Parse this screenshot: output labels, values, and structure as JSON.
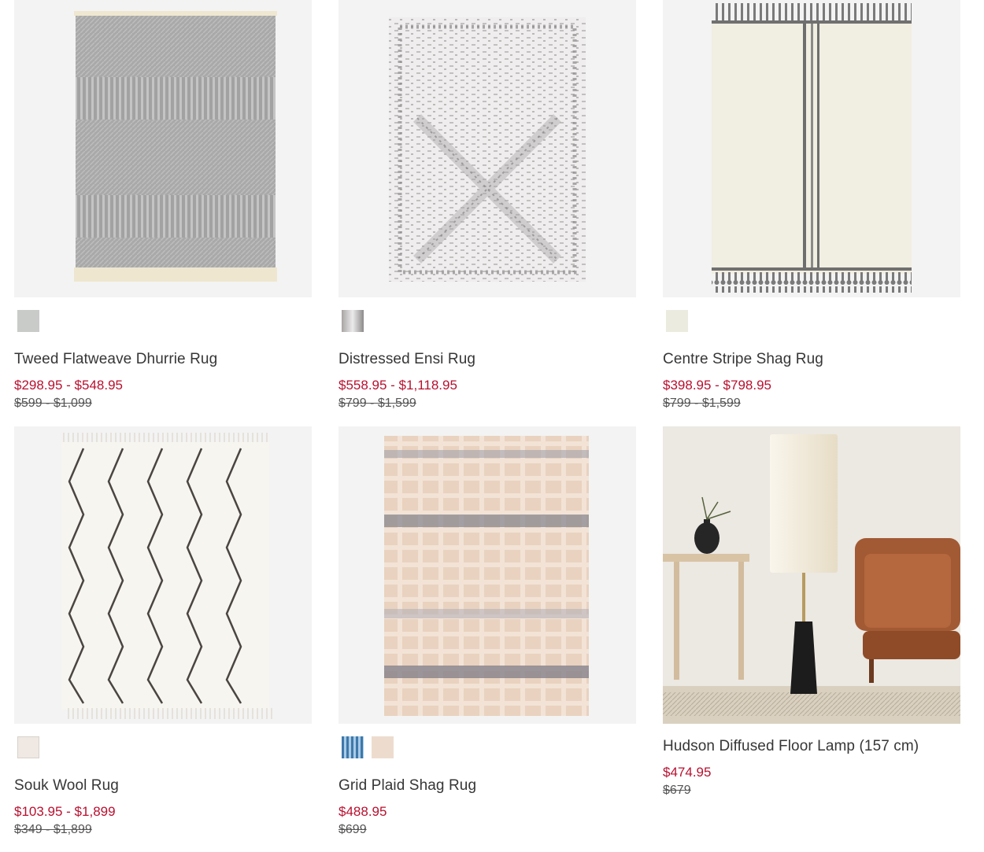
{
  "products": [
    {
      "title": "Tweed Flatweave Dhurrie Rug",
      "price": "$298.95 - $548.95",
      "original_price": "$599 - $1,099",
      "swatches": [
        "#c9cbc8"
      ]
    },
    {
      "title": "Distressed Ensi Rug",
      "price": "$558.95 - $1,118.95",
      "original_price": "$799 - $1,599",
      "swatches": [
        "#cfcdcd"
      ]
    },
    {
      "title": "Centre Stripe Shag Rug",
      "price": "$398.95 - $798.95",
      "original_price": "$799 - $1,599",
      "swatches": [
        "#ecebdf"
      ]
    },
    {
      "title": "Souk Wool Rug",
      "price": "$103.95 - $1,899",
      "original_price": "$349 - $1,899",
      "swatches": [
        "#efe8e3"
      ]
    },
    {
      "title": "Grid Plaid Shag Rug",
      "price": "$488.95",
      "original_price": "$699",
      "swatches": [
        "#5f95bf",
        "#eddcce"
      ]
    },
    {
      "title": "Hudson Diffused Floor Lamp (157 cm)",
      "price": "$474.95",
      "original_price": "$679",
      "swatches": []
    }
  ],
  "colors": {
    "sale_price": "#b8102f",
    "image_bg": "#f3f3f3"
  }
}
